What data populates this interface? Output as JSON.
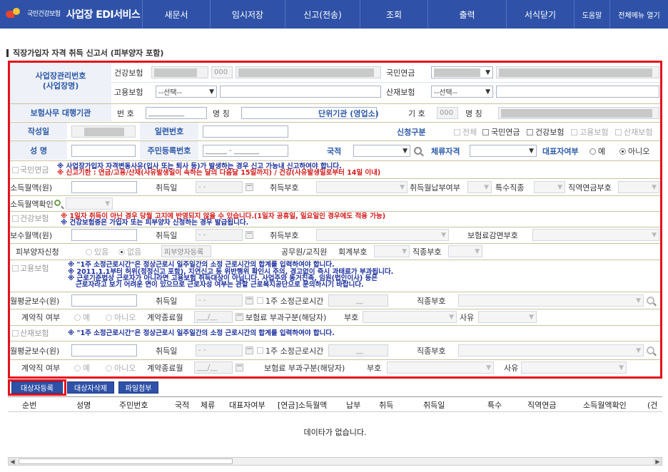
{
  "header": {
    "logo_text": "국민건강보험",
    "app_title": "사업장 EDI서비스",
    "menus": [
      "새문서",
      "임시저장",
      "신고(전송)",
      "조회",
      "출력",
      "서식닫기"
    ],
    "help": "도움말",
    "all_menu": "전체메뉴 열기"
  },
  "page_title": "직장가입자 자격 취득 신고서 (피부양자 포함)",
  "employer": {
    "label_line1": "사업장관리번호",
    "label_line2": "(사업장명)",
    "health": "건강보험",
    "health_code": "000",
    "pension": "국민연금",
    "employment": "고용보험",
    "select_placeholder": "--선택--",
    "industrial": "산재보험",
    "agency_label": "보험사무 대행기관",
    "agency_no": "번 호",
    "agency_no_value": "__________",
    "agency_name": "명 칭",
    "unit_label": "단위기관 (영업소)",
    "unit_code": "기 호",
    "unit_code_value": "000",
    "unit_name": "명 칭"
  },
  "applicant": {
    "created": "작성일",
    "serial": "일련번호",
    "apply_type": "신청구분",
    "opt_all": "전체",
    "opt_pension": "국민연금",
    "opt_health": "건강보험",
    "opt_employment": "고용보험",
    "opt_industrial": "산재보험",
    "name": "성 명",
    "rrn": "주민등록번호",
    "rrn_value": "______ - _______",
    "nationality": "국적",
    "residence": "체류자격",
    "representative": "대표자여부",
    "yes": "예",
    "no": "아니오"
  },
  "pension": {
    "title": "국민연금",
    "notice1": "※ 사업장가입자 자격변동사유(입사 또는 퇴사 등)가 발생하는 경우 신고 가능내 신고하여야 합니다.",
    "notice2": "※ 신고기한 : 연금/고용/산재(사유발생일이 속하는 달의 다음달 15일까지) / 건강(사유발생일로부터 14일 이내)",
    "income": "소득월액(원)",
    "acquire_date": "취득일",
    "date_placeholder": "- -",
    "acquire_code": "취득부호",
    "pay_wish": "취득월납부여부",
    "special_job": "특수직종",
    "job_pension": "직역연금부호",
    "income_confirm": "소득월액확인"
  },
  "health": {
    "title": "건강보험",
    "notice1": "※ 1일자 취득이 아닌 경우 당월 고지에 반영되지 않을 수 있습니다.(1일자 공휴일, 일요일인 경우에도 적용 가능)",
    "notice2": "※ 건강보험증은 가입자 또는 피부양자 신청하는 경우 발급됩니다.",
    "pay": "보수월액(원)",
    "acquire_date": "취득일",
    "acquire_code": "취득부호",
    "discount": "보험료감면부호",
    "dependent": "피부양자신청",
    "dep_yes": "있음",
    "dep_no": "없음",
    "dep_button": "피부양자등록",
    "civil": "공무원/교직원",
    "account": "회계부호",
    "job_code": "직종부호"
  },
  "employment": {
    "title": "고용보험",
    "notice1": "※ \"1주 소정근로시간\"은 정상근로시 일주일간의 소정 근로시간의 합계를 입력하여야 합니다.",
    "notice2": "※ 2011.1.1부터 허위(정정신고 포함), 지연신고 등 위반행위 확인시 주의, 경고없이 즉시 과태료가 부과됩니다.",
    "notice3": "※ 근로기준법상 근로자가 아니라면 고용보험 취득대상이 아닙니다. 사업주와 동거친족, 임원(법인이사) 등은",
    "notice4": "근로자라고 보기 어려운 면이 있으므로 근로자성 여부는 관할 근로복지공단으로 문의하시기 바랍니다.",
    "avg_pay": "월평균보수(원)",
    "acquire_date": "취득일",
    "weekly_hours": "1주 소정근로시간",
    "hours_placeholder": "__",
    "job_code": "직종부호",
    "contract": "계약직 여부",
    "yes": "예",
    "no": "아니오",
    "contract_end": "계약종료월",
    "month_placeholder": "___/__",
    "premium_type": "보험료 부과구분(해당자)",
    "code": "부호",
    "reason": "사유"
  },
  "industrial": {
    "title": "산재보험",
    "notice1": "※ \"1주 소정근로시간\"은 정상근로시 일주일간의 소정 근로시간의 합계를 입력하여야 합니다.",
    "avg_pay": "월평균보수(원)",
    "acquire_date": "취득일",
    "weekly_hours": "1주 소정근로시간",
    "hours_placeholder": "__",
    "job_code": "직종부호",
    "contract": "계약직 여부",
    "yes": "예",
    "no": "아니오",
    "contract_end": "계약종료월",
    "month_placeholder": "___/__",
    "premium_type": "보험료 부과구분(해당자)",
    "code": "부호",
    "reason": "사유"
  },
  "actions": {
    "register": "대상자등록",
    "delete": "대상자삭제",
    "attach": "파일첨부"
  },
  "grid": {
    "columns": [
      "순번",
      "성명",
      "주민번호",
      "국적",
      "체류",
      "대표자여부",
      "[연금]소득월액",
      "납부",
      "취득",
      "취득일",
      "특수",
      "직역연금",
      "소득월액확인",
      "(건"
    ],
    "empty": "데이타가 없습니다."
  },
  "colors": {
    "nav_bg": "#2f52a8",
    "frame_red": "#e5121b",
    "label_blue": "#2d5aa7",
    "notice_blue": "#1b2f9c",
    "notice_red": "#d61a1a"
  }
}
